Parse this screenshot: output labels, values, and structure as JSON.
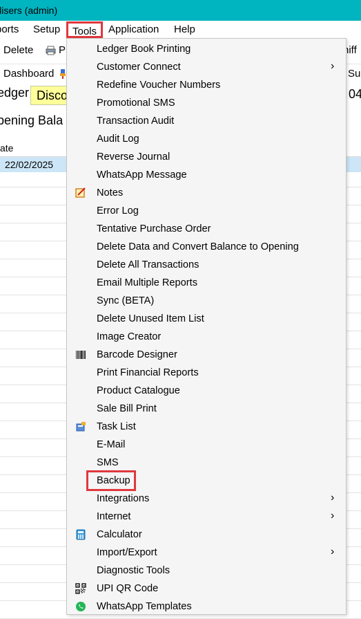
{
  "window": {
    "title": "ilisers (admin)"
  },
  "menubar": {
    "reports": "ports",
    "setup": "Setup",
    "tools": "Tools",
    "application": "Application",
    "help": "Help"
  },
  "toolbar": {
    "delete": "Delete",
    "print_partial": "P",
    "right_partial": "niff",
    "dashboard": "Dashboard",
    "right2_partial": "Sur"
  },
  "form": {
    "ledger_label": "edger",
    "account_value": "Disco",
    "right_value": "04",
    "opening_label": "pening Bala"
  },
  "grid": {
    "header_date": "ate",
    "selected_row_date": "22/02/2025"
  },
  "tools_menu": {
    "items": [
      {
        "label": "Ledger Book Printing"
      },
      {
        "label": "Customer Connect",
        "submenu": true
      },
      {
        "label": "Redefine Voucher Numbers"
      },
      {
        "label": "Promotional SMS"
      },
      {
        "label": "Transaction Audit"
      },
      {
        "label": "Audit Log"
      },
      {
        "label": "Reverse Journal"
      },
      {
        "label": "WhatsApp Message"
      },
      {
        "label": "Notes",
        "icon": "notes-icon"
      },
      {
        "label": "Error Log"
      },
      {
        "label": "Tentative Purchase Order"
      },
      {
        "label": "Delete Data and Convert Balance to Opening"
      },
      {
        "label": "Delete All Transactions"
      },
      {
        "label": "Email Multiple Reports"
      },
      {
        "label": "Sync (BETA)"
      },
      {
        "label": "Delete Unused Item List"
      },
      {
        "label": "Image Creator"
      },
      {
        "label": "Barcode Designer",
        "icon": "barcode-icon"
      },
      {
        "label": "Print Financial Reports"
      },
      {
        "label": "Product Catalogue"
      },
      {
        "label": "Sale Bill Print"
      },
      {
        "label": "Task List",
        "icon": "task-list-icon"
      },
      {
        "label": "E-Mail"
      },
      {
        "label": "SMS"
      },
      {
        "label": "Backup",
        "highlighted": true
      },
      {
        "label": "Integrations",
        "submenu": true
      },
      {
        "label": "Internet",
        "submenu": true
      },
      {
        "label": "Calculator",
        "icon": "calculator-icon"
      },
      {
        "label": "Import/Export",
        "submenu": true
      },
      {
        "label": "Diagnostic Tools"
      },
      {
        "label": "UPI QR Code",
        "icon": "qr-code-icon"
      },
      {
        "label": "WhatsApp Templates",
        "icon": "whatsapp-icon"
      }
    ],
    "submenu_arrow": "›"
  },
  "colors": {
    "titlebar": "#00b4c0",
    "highlight_border": "#e0383e",
    "menu_background": "#f5f5f5",
    "selected_row": "#cde6f7",
    "account_field": "#ffff99"
  }
}
